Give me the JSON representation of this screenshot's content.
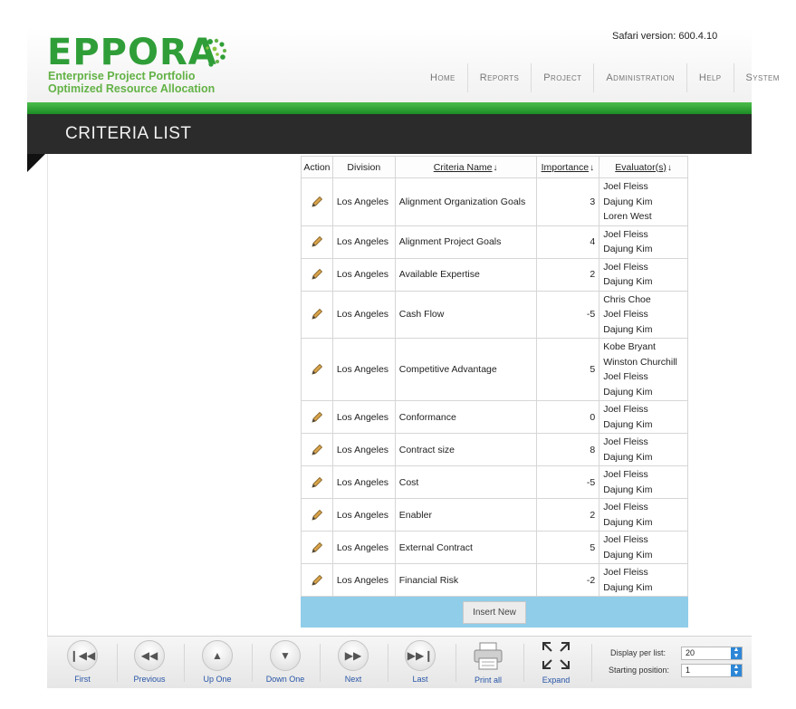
{
  "header": {
    "logo_word": "EPPORA",
    "logo_line1": "Enterprise Project Portfolio",
    "logo_line2": "Optimized Resource Allocation",
    "safari_version": "Safari version: 600.4.10",
    "nav": [
      "Home",
      "Reports",
      "Project",
      "Administration",
      "Help",
      "System"
    ]
  },
  "page_title": "CRITERIA LIST",
  "table": {
    "headers": {
      "action": "Action",
      "division": "Division",
      "criteria_name": "Criteria Name",
      "importance": "Importance",
      "evaluators": "Evaluator(s)"
    },
    "rows": [
      {
        "division": "Los Angeles",
        "name": "Alignment Organization Goals",
        "importance": "3",
        "evaluators": [
          "Joel Fleiss",
          "Dajung Kim",
          "Loren West"
        ]
      },
      {
        "division": "Los Angeles",
        "name": "Alignment Project Goals",
        "importance": "4",
        "evaluators": [
          "Joel Fleiss",
          "Dajung Kim"
        ]
      },
      {
        "division": "Los Angeles",
        "name": "Available Expertise",
        "importance": "2",
        "evaluators": [
          "Joel Fleiss",
          "Dajung Kim"
        ]
      },
      {
        "division": "Los Angeles",
        "name": "Cash Flow",
        "importance": "-5",
        "evaluators": [
          "Chris Choe",
          "Joel Fleiss",
          "Dajung Kim"
        ]
      },
      {
        "division": "Los Angeles",
        "name": "Competitive Advantage",
        "importance": "5",
        "evaluators": [
          "Kobe Bryant",
          "Winston Churchill",
          "Joel Fleiss",
          "Dajung Kim"
        ]
      },
      {
        "division": "Los Angeles",
        "name": "Conformance",
        "importance": "0",
        "evaluators": [
          "Joel Fleiss",
          "Dajung Kim"
        ]
      },
      {
        "division": "Los Angeles",
        "name": "Contract size",
        "importance": "8",
        "evaluators": [
          "Joel Fleiss",
          "Dajung Kim"
        ]
      },
      {
        "division": "Los Angeles",
        "name": "Cost",
        "importance": "-5",
        "evaluators": [
          "Joel Fleiss",
          "Dajung Kim"
        ]
      },
      {
        "division": "Los Angeles",
        "name": "Enabler",
        "importance": "2",
        "evaluators": [
          "Joel Fleiss",
          "Dajung Kim"
        ]
      },
      {
        "division": "Los Angeles",
        "name": "External Contract",
        "importance": "5",
        "evaluators": [
          "Joel Fleiss",
          "Dajung Kim"
        ]
      },
      {
        "division": "Los Angeles",
        "name": "Financial Risk",
        "importance": "-2",
        "evaluators": [
          "Joel Fleiss",
          "Dajung Kim"
        ]
      }
    ],
    "insert_label": "Insert New"
  },
  "footer": {
    "first": "First",
    "previous": "Previous",
    "up_one": "Up One",
    "down_one": "Down One",
    "next": "Next",
    "last": "Last",
    "print_all": "Print all",
    "expand": "Expand",
    "display_per_list_label": "Display per list:",
    "display_per_list_value": "20",
    "starting_position_label": "Starting position:",
    "starting_position_value": "1"
  },
  "colors": {
    "brand_green": "#2f9e38",
    "title_bar": "#2b2b2b",
    "insert_bar": "#8fcde9",
    "link_blue": "#2754a6"
  }
}
